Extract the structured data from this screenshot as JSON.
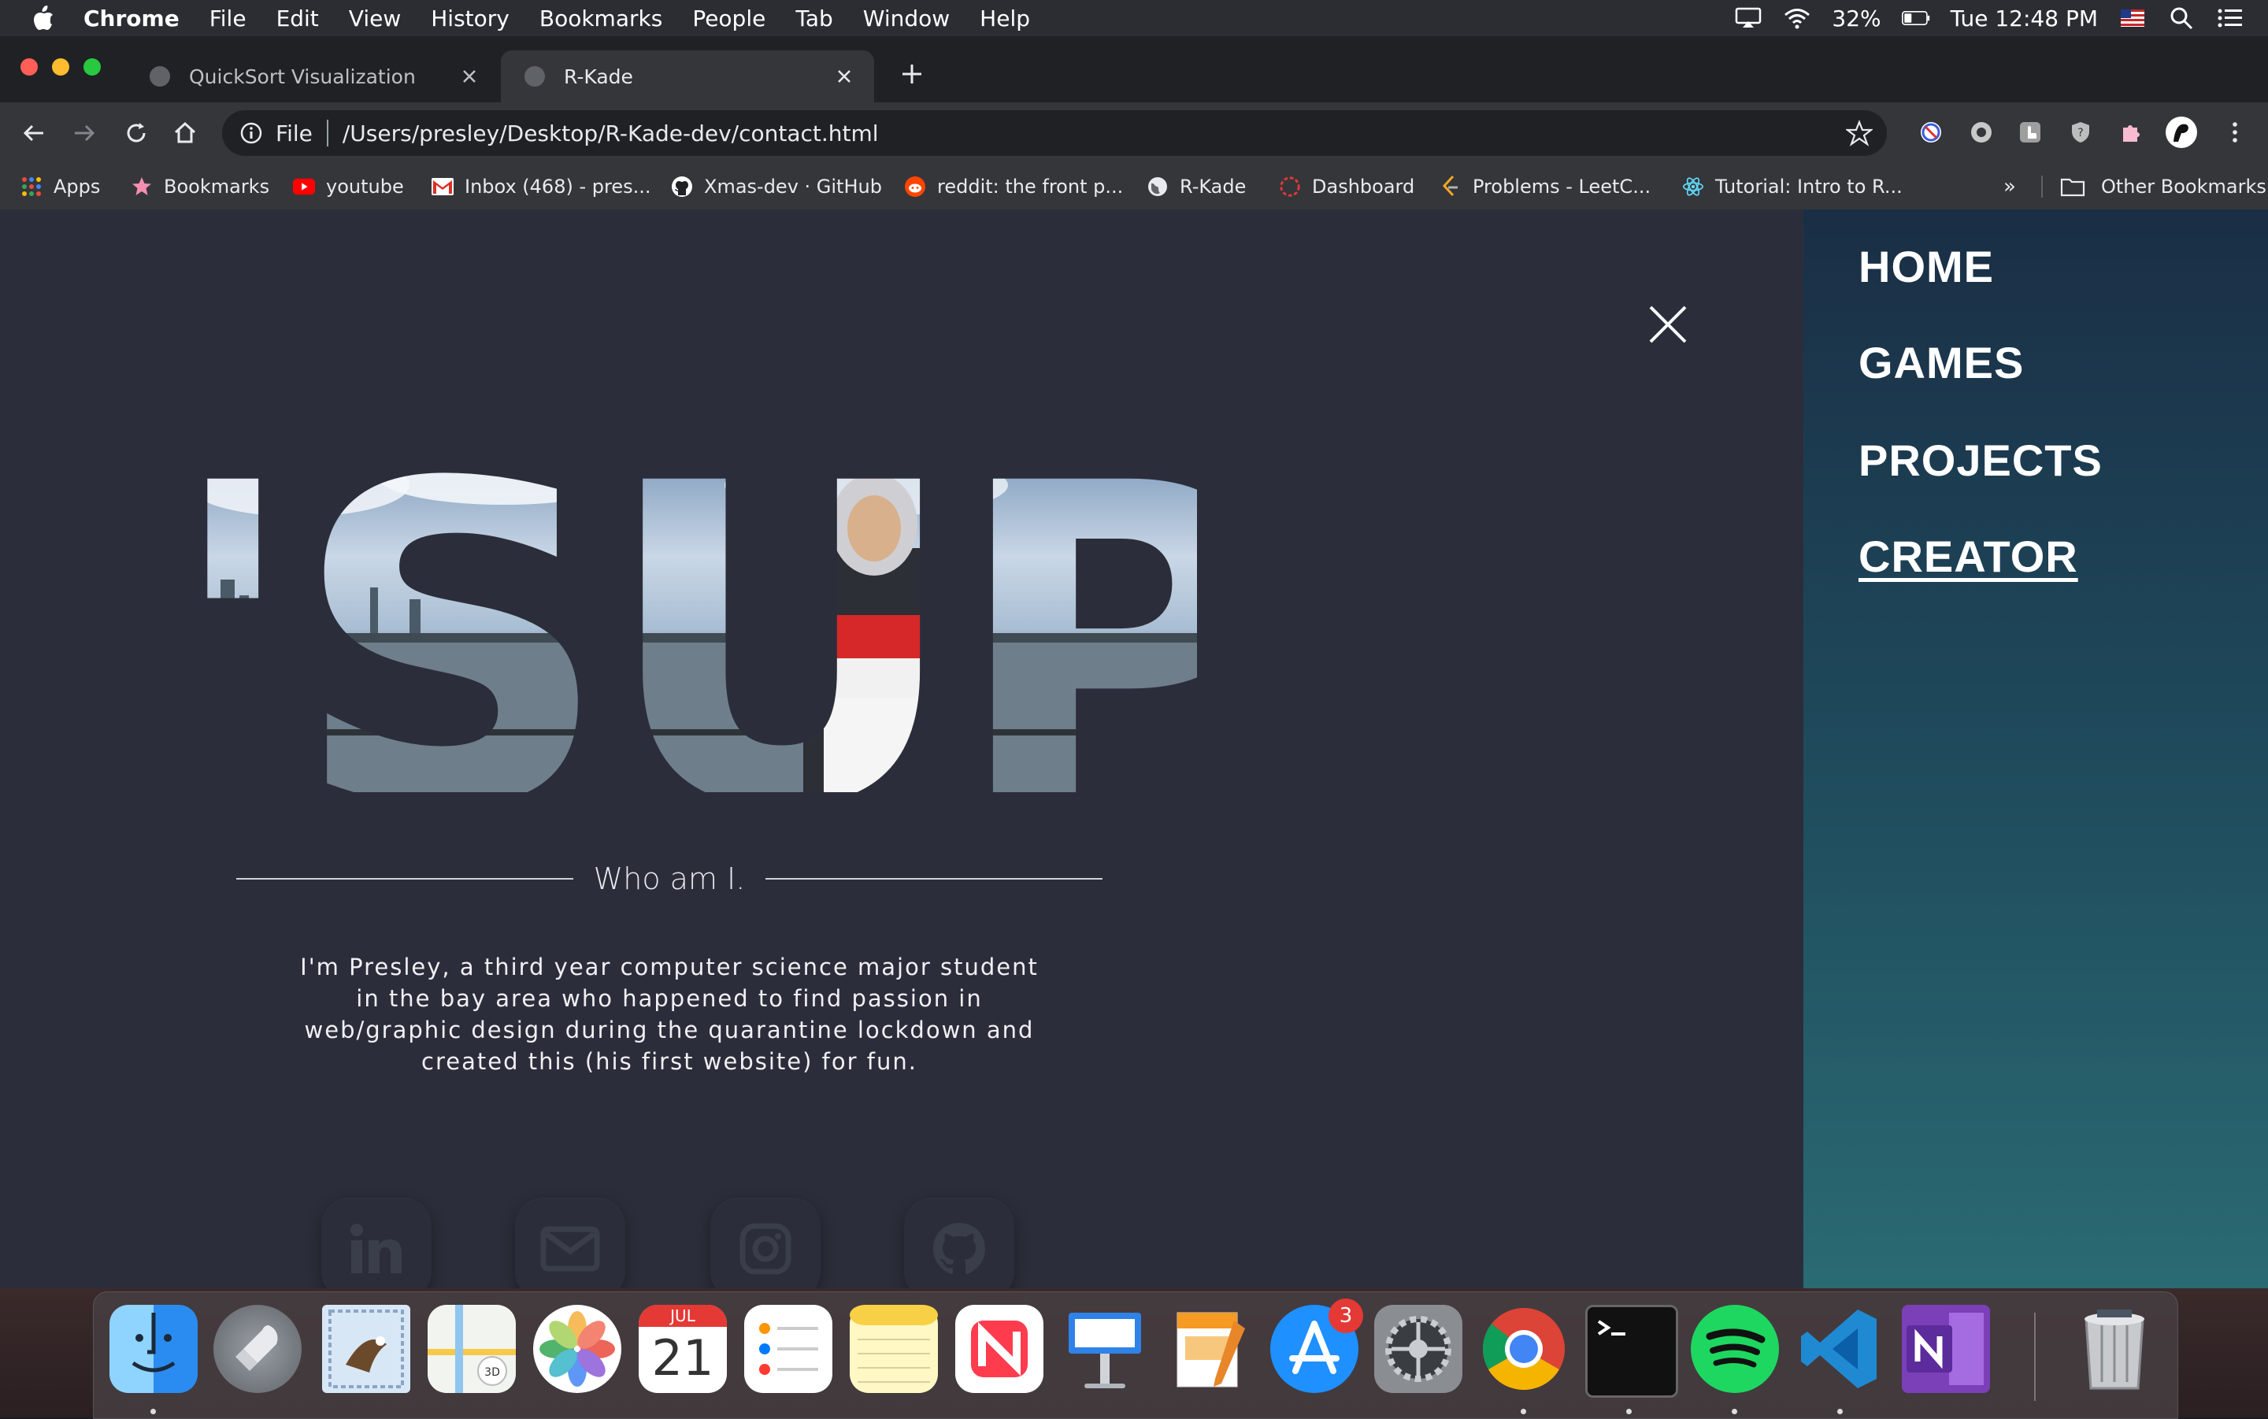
{
  "menubar": {
    "app": "Chrome",
    "items": [
      "File",
      "Edit",
      "View",
      "History",
      "Bookmarks",
      "People",
      "Tab",
      "Window",
      "Help"
    ],
    "battery": "32%",
    "clock": "Tue 12:48 PM"
  },
  "tabs": [
    {
      "title": "QuickSort Visualization",
      "active": false
    },
    {
      "title": "R-Kade",
      "active": true
    }
  ],
  "address": {
    "scheme": "File",
    "url": "/Users/presley/Desktop/R-Kade-dev/contact.html"
  },
  "bookmarks": [
    {
      "label": "Apps",
      "icon": "apps-grid-icon"
    },
    {
      "label": "Bookmarks",
      "icon": "star-icon"
    },
    {
      "label": "youtube",
      "icon": "youtube-icon"
    },
    {
      "label": "Inbox (468) - pres...",
      "icon": "gmail-icon"
    },
    {
      "label": "Xmas-dev · GitHub",
      "icon": "github-icon"
    },
    {
      "label": "reddit: the front p...",
      "icon": "reddit-icon"
    },
    {
      "label": "R-Kade",
      "icon": "globe-icon"
    },
    {
      "label": "Dashboard",
      "icon": "dashboard-icon"
    },
    {
      "label": "Problems - LeetC...",
      "icon": "leetcode-icon"
    },
    {
      "label": "Tutorial: Intro to R...",
      "icon": "react-icon"
    }
  ],
  "bookmarks_overflow": "»",
  "other_bookmarks": "Other Bookmarks",
  "page": {
    "hero_text": "'SUP",
    "subtitle": "Who am I.",
    "bio": "I'm Presley, a third year computer science major student in the bay area who happened to find passion in web/graphic design during the quarantine lockdown and created this (his first website) for fun.",
    "social": [
      "linkedin-icon",
      "mail-icon",
      "instagram-icon",
      "github-icon"
    ]
  },
  "nav": {
    "items": [
      "HOME",
      "GAMES",
      "PROJECTS",
      "CREATOR"
    ],
    "active": "CREATOR"
  },
  "dock": {
    "apps": [
      "Finder",
      "Launchpad",
      "Mail",
      "Maps",
      "Photos",
      "Calendar",
      "Reminders",
      "Notes",
      "News",
      "Keynote",
      "Pages",
      "App Store",
      "System Preferences",
      "Chrome",
      "Terminal",
      "Spotify",
      "VS Code",
      "OneNote",
      "Trash"
    ],
    "calendar_month": "JUL",
    "calendar_day": "21",
    "app_store_badge": "3"
  }
}
